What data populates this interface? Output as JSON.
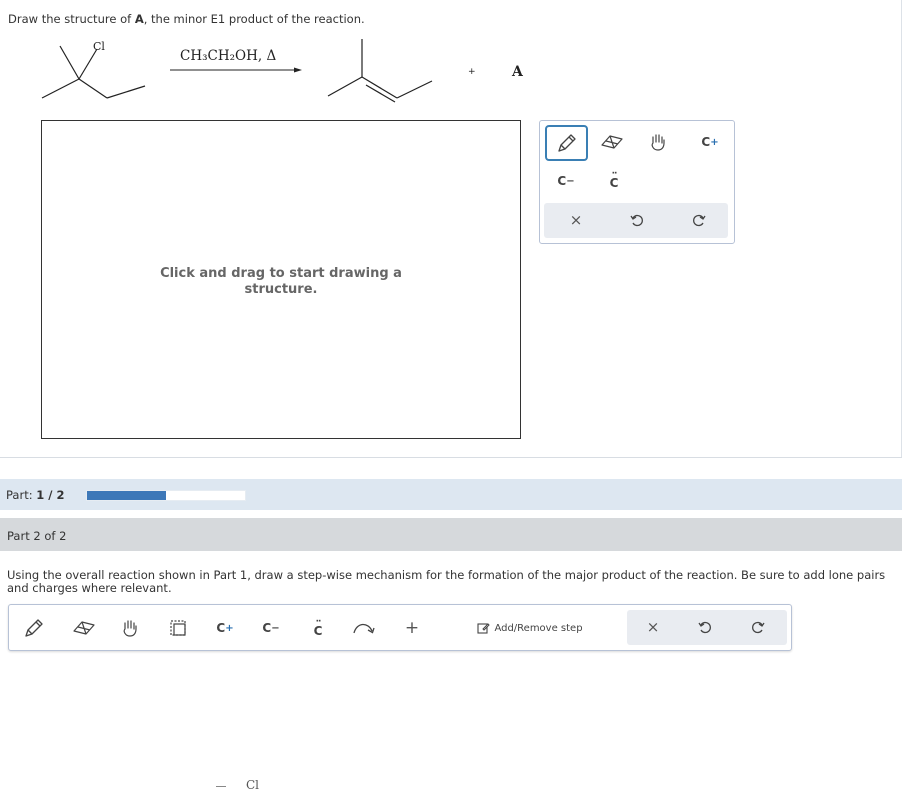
{
  "question": {
    "prefix": "Draw the structure of ",
    "bold": "A",
    "suffix": ", the minor E1 product of the reaction."
  },
  "reaction": {
    "reactant_label": "Cl",
    "conditions": "CH₃CH₂OH, Δ",
    "plus": "+",
    "product_label": "A"
  },
  "canvas1": {
    "hint": "Click and drag to start drawing a structure."
  },
  "toolbar1": {
    "tools": [
      "pencil-icon",
      "eraser-icon",
      "hand-icon",
      "carbocation-icon",
      "carbanion-icon",
      "lone-pair-icon",
      "clear-icon",
      "undo-icon",
      "redo-icon"
    ],
    "carbocation": "C",
    "carbocation_sup": "+",
    "carbanion": "C",
    "carbanion_sup": "−",
    "lonepair": "C",
    "clear": "×"
  },
  "part1": {
    "label_prefix": "Part: ",
    "label_value": "1 / 2",
    "progress": 0.5
  },
  "part2": {
    "label": "Part 2 of 2",
    "instructions": "Using the overall reaction shown in Part 1, draw a step-wise mechanism for the formation of the major product of the reaction. Be sure to add lone pairs and charges where relevant."
  },
  "toolbar2": {
    "carbocation": "C",
    "carbocation_sup": "+",
    "carbanion": "C",
    "carbanion_sup": "−",
    "lonepair": "C",
    "plus": "+",
    "add_remove_step": "Add/Remove step",
    "clear": "×"
  },
  "canvas2": {
    "partial_label": "Cl"
  },
  "colors": {
    "accent": "#3d78b8",
    "part_bar": "#dde7f1",
    "part2_bar": "#d6d9dc",
    "toolbar_border": "#b7c2d6"
  }
}
